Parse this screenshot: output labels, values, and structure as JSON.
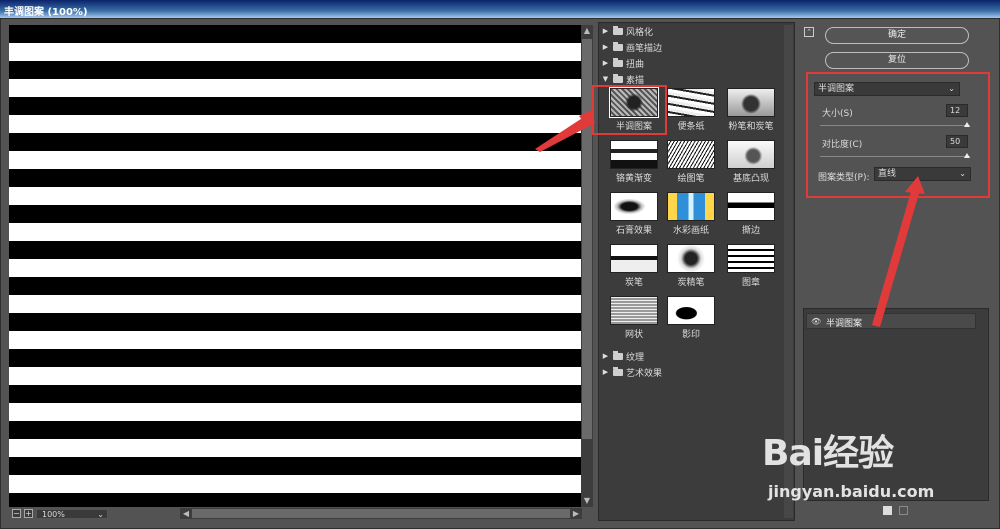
{
  "window": {
    "title": "丰调图案 (100%)"
  },
  "preview": {
    "zoom": "100%"
  },
  "gallery": {
    "categories_top": [
      "风格化",
      "画笔描边",
      "扭曲",
      "素描"
    ],
    "categories_bottom": [
      "纹理",
      "艺术效果"
    ],
    "filters": [
      "半调图案",
      "便条纸",
      "粉笔和炭笔",
      "铬黄渐变",
      "绘图笔",
      "基底凸现",
      "石膏效果",
      "水彩画纸",
      "撕边",
      "炭笔",
      "炭精笔",
      "图章",
      "网状",
      "影印"
    ],
    "selected": "半调图案"
  },
  "buttons": {
    "ok": "确定",
    "reset": "复位"
  },
  "settings": {
    "filter_select": "半调图案",
    "size_label": "大小(S)",
    "size_value": "12",
    "size_fraction": 0.98,
    "contrast_label": "对比度(C)",
    "contrast_value": "50",
    "contrast_fraction": 0.98,
    "pattern_type_label": "图案类型(P):",
    "pattern_type_value": "直线"
  },
  "layers": {
    "items": [
      "半调图案"
    ]
  },
  "watermark": {
    "brand": "Bai经验",
    "url": "jingyan.baidu.com"
  },
  "colors": {
    "highlight": "#e13a3a",
    "panel": "#535353"
  }
}
